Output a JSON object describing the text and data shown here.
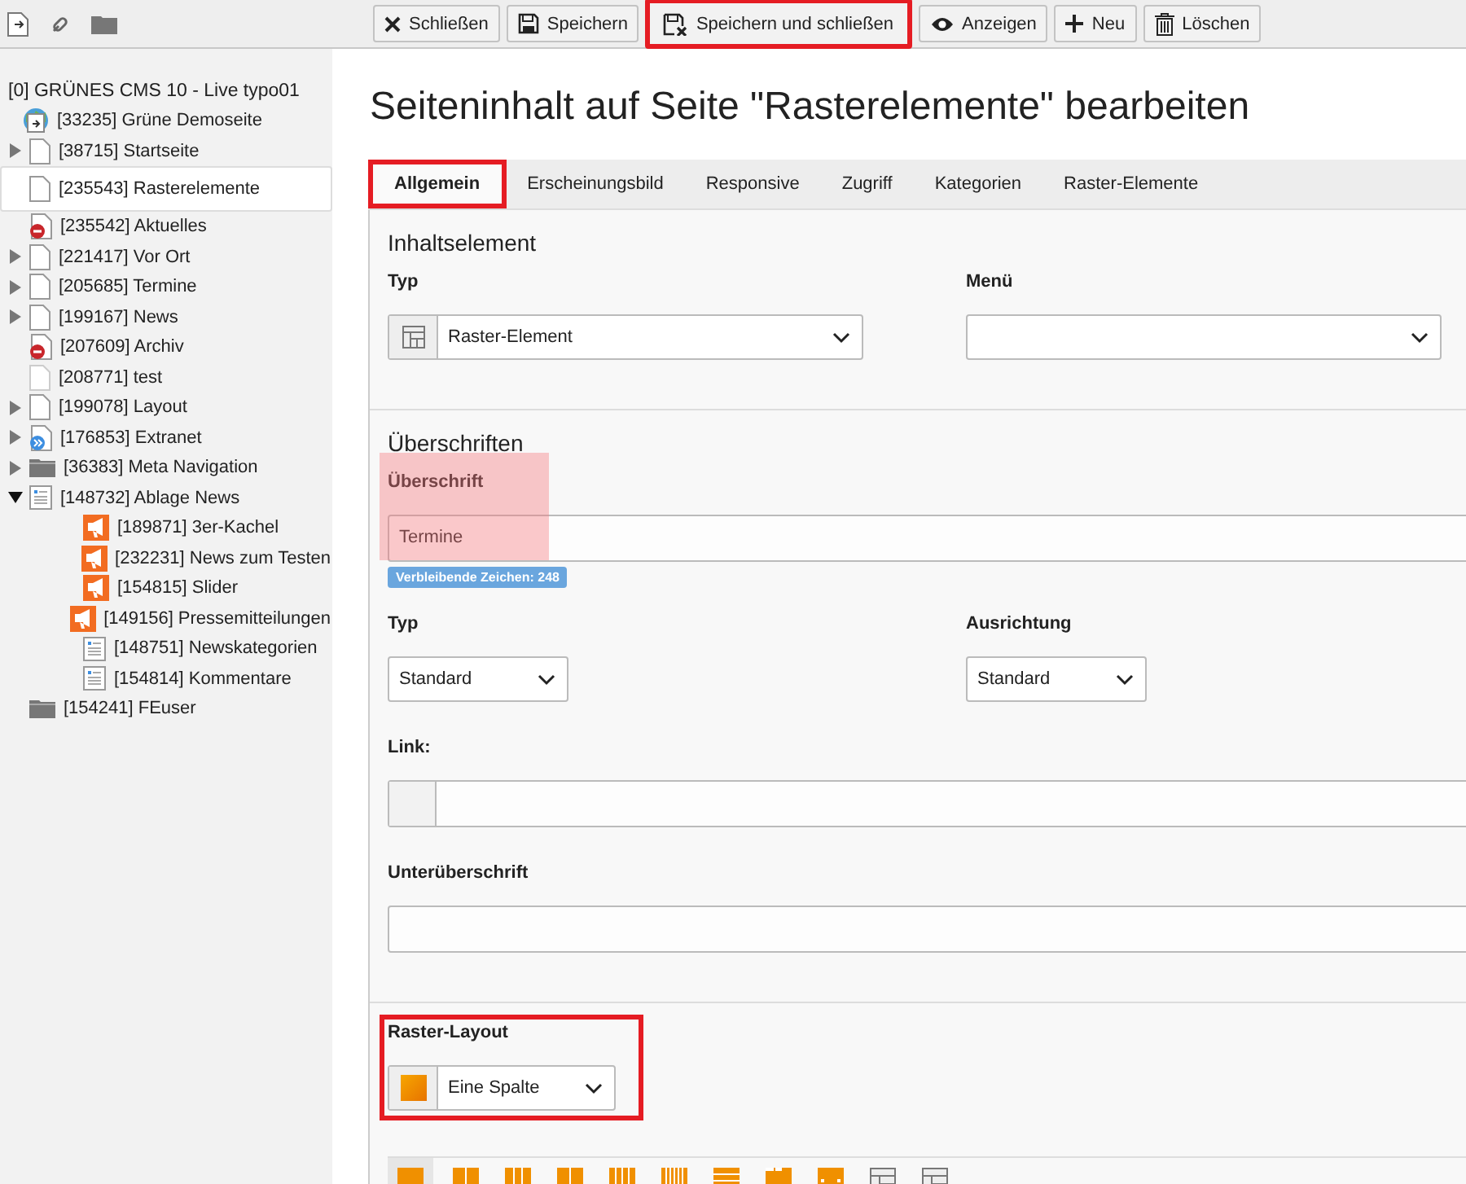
{
  "sidebar_toolbar": {
    "icons": [
      {
        "kind": "new-page"
      },
      {
        "kind": "link"
      },
      {
        "kind": "folder"
      }
    ]
  },
  "tree": {
    "label": "[0] GRÜNES CMS 10 - Live typo01",
    "children": [
      {
        "label": "[33235] Grüne Demoseite",
        "kind": "site",
        "children": [
          {
            "label": "[38715] Startseite",
            "kind": "page",
            "has_children": true,
            "selected": false
          },
          {
            "label": "[235543] Rasterelemente",
            "kind": "page",
            "has_children": false,
            "selected": true
          },
          {
            "label": "[235542] Aktuelles",
            "kind": "page-hidden",
            "has_children": false,
            "selected": false
          },
          {
            "label": "[221417] Vor Ort",
            "kind": "page",
            "has_children": true,
            "selected": false
          },
          {
            "label": "[205685] Termine",
            "kind": "page",
            "has_children": true,
            "selected": false
          },
          {
            "label": "[199167] News",
            "kind": "page",
            "has_children": true,
            "selected": false
          },
          {
            "label": "[207609] Archiv",
            "kind": "page-hidden",
            "has_children": false,
            "selected": false
          },
          {
            "label": "[208771] test",
            "kind": "page-faded",
            "has_children": false,
            "selected": false
          },
          {
            "label": "[199078] Layout",
            "kind": "page",
            "has_children": true,
            "selected": false
          },
          {
            "label": "[176853] Extranet",
            "kind": "page-link",
            "has_children": true,
            "selected": false
          },
          {
            "label": "[36383] Meta Navigation",
            "kind": "folder",
            "has_children": true,
            "selected": false
          },
          {
            "label": "[148732] Ablage News",
            "kind": "list",
            "has_children": true,
            "expanded": true,
            "selected": false,
            "children": [
              {
                "label": "[189871] 3er-Kachel",
                "kind": "news",
                "selected": false
              },
              {
                "label": "[232231] News zum Testen",
                "kind": "news",
                "selected": false
              },
              {
                "label": "[154815] Slider",
                "kind": "news",
                "selected": false
              },
              {
                "label": "[149156] Pressemitteilungen",
                "kind": "news",
                "selected": false
              },
              {
                "label": "[148751] Newskategorien",
                "kind": "list",
                "selected": false
              },
              {
                "label": "[154814] Kommentare",
                "kind": "list",
                "selected": false
              }
            ]
          },
          {
            "label": "[154241] FEuser",
            "kind": "folder",
            "has_children": false,
            "selected": false
          }
        ]
      }
    ]
  },
  "toolbar": {
    "buttons": [
      {
        "label": "Schließen",
        "kind": "close",
        "highlighted": false
      },
      {
        "label": "Speichern",
        "kind": "save",
        "highlighted": false
      },
      {
        "label": "Speichern und schließen",
        "kind": "save-close",
        "highlighted": true
      },
      {
        "label": "Anzeigen",
        "kind": "view",
        "highlighted": false
      },
      {
        "label": "Neu",
        "kind": "new",
        "highlighted": false
      },
      {
        "label": "Löschen",
        "kind": "delete",
        "highlighted": false
      }
    ]
  },
  "title": "Seiteninhalt auf Seite \"Rasterelemente\" bearbeiten",
  "tabs": [
    {
      "label": "Allgemein",
      "selected": true,
      "highlighted": true
    },
    {
      "label": "Erscheinungsbild",
      "selected": false,
      "highlighted": false
    },
    {
      "label": "Responsive",
      "selected": false,
      "highlighted": false
    },
    {
      "label": "Zugriff",
      "selected": false,
      "highlighted": false
    },
    {
      "label": "Kategorien",
      "selected": false,
      "highlighted": false
    },
    {
      "label": "Raster-Elemente",
      "selected": false,
      "highlighted": false
    }
  ],
  "sections": [
    {
      "heading": "Inhaltselement",
      "rows": [
        [
          {
            "label": "Typ",
            "kind": "type-select",
            "value": "Raster-Element"
          },
          {
            "label": "Menü",
            "kind": "select"
          }
        ]
      ]
    },
    {
      "heading": "Überschriften",
      "rows": [
        [
          {
            "label": "Überschrift",
            "kind": "text",
            "value": "Termine",
            "error": true,
            "counter": "Verbleibende Zeichen: 248"
          }
        ],
        [
          {
            "label": "Typ",
            "kind": "select",
            "value": "Standard"
          },
          {
            "label": "Ausrichtung",
            "kind": "select",
            "value": "Standard"
          }
        ],
        [
          {
            "label": "Link:",
            "kind": "link"
          }
        ],
        [
          {
            "label": "Unterüberschrift",
            "kind": "text"
          }
        ]
      ]
    },
    {
      "rows": [
        [
          {
            "label": "Raster-Layout",
            "kind": "layout-select",
            "value": "Eine Spalte",
            "highlighted": true
          }
        ]
      ],
      "layout_options": [
        {
          "kind": "block",
          "selected": true
        },
        {
          "kind": "columns-2",
          "selected": false
        },
        {
          "kind": "columns-3",
          "selected": false
        },
        {
          "kind": "columns-2",
          "selected": false
        },
        {
          "kind": "columns-4",
          "selected": false
        },
        {
          "kind": "columns-6",
          "selected": false
        },
        {
          "kind": "rows",
          "selected": false
        },
        {
          "kind": "tabs",
          "selected": false
        },
        {
          "kind": "slider",
          "selected": false
        },
        {
          "kind": "table",
          "selected": false
        },
        {
          "kind": "table",
          "selected": false
        }
      ]
    }
  ]
}
